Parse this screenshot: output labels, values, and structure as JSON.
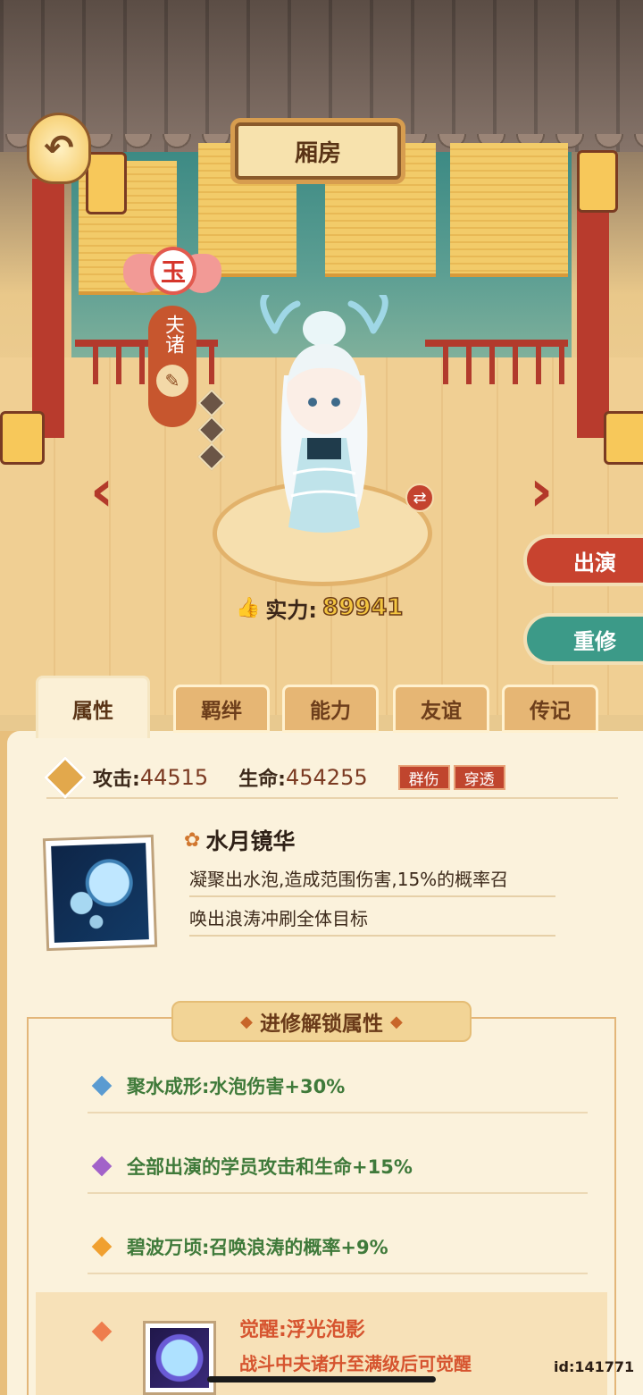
{
  "header": {
    "title": "厢房",
    "back_icon": "back-arrow-icon"
  },
  "character": {
    "rank_glyph": "玉",
    "name": "夫诸",
    "power_label": "实力:",
    "power_value": "89941"
  },
  "actions": {
    "perform_label": "出演",
    "retrain_label": "重修"
  },
  "tabs": [
    {
      "label": "属性",
      "active": true
    },
    {
      "label": "羁绊",
      "active": false
    },
    {
      "label": "能力",
      "active": false
    },
    {
      "label": "友谊",
      "active": false
    },
    {
      "label": "传记",
      "active": false
    }
  ],
  "stats": {
    "attack_label": "攻击:",
    "attack_value": "44515",
    "hp_label": "生命:",
    "hp_value": "454255",
    "tags": [
      "群伤",
      "穿透"
    ]
  },
  "skill": {
    "name": "水月镜华",
    "desc_line1": "凝聚出水泡,造成范围伤害,15%的概率召",
    "desc_line2": "唤出浪涛冲刷全体目标"
  },
  "unlock_section": {
    "title": "进修解锁属性",
    "perks": [
      {
        "text": "聚水成形:水泡伤害+30%",
        "color": "#5a9bd1"
      },
      {
        "text": "全部出演的学员攻击和生命+15%",
        "color": "#a262c9"
      },
      {
        "text": "碧波万顷:召唤浪涛的概率+9%",
        "color": "#f0a030"
      }
    ],
    "awaken_title": "觉醒:浮光泡影",
    "awaken_desc": "战斗中夫诸升至满级后可觉醒"
  },
  "footer": {
    "uid": "id:141771"
  },
  "colors": {
    "accent_red": "#c8432f",
    "accent_teal": "#3c9a88",
    "panel_bg": "#fbf2dc"
  }
}
